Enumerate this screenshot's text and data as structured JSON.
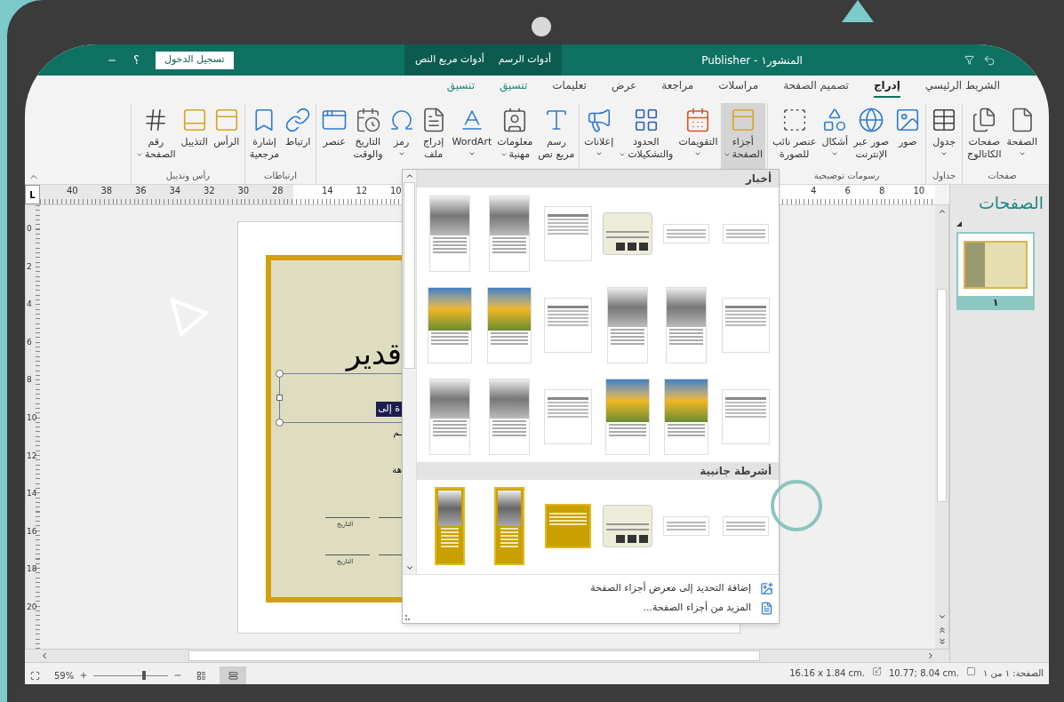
{
  "title_bar": {
    "title": "المنشور١ - Publisher",
    "contextual_tabs": [
      "أدوات الرسم",
      "أدوات مربع النص"
    ],
    "sign_in": "تسجيل الدخول",
    "help": "؟"
  },
  "tabs": [
    {
      "label": "الشريط الرئيسي",
      "selected": false,
      "contextual": false
    },
    {
      "label": "إدراج",
      "selected": true,
      "contextual": false
    },
    {
      "label": "تصميم الصفحة",
      "selected": false,
      "contextual": false
    },
    {
      "label": "مراسلات",
      "selected": false,
      "contextual": false
    },
    {
      "label": "مراجعة",
      "selected": false,
      "contextual": false
    },
    {
      "label": "عرض",
      "selected": false,
      "contextual": false
    },
    {
      "label": "تعليمات",
      "selected": false,
      "contextual": false
    },
    {
      "label": "تنسيق",
      "selected": false,
      "contextual": true
    },
    {
      "label": "تنسيق",
      "selected": false,
      "contextual": true
    }
  ],
  "ribbon": {
    "groups": [
      {
        "label": "صفحات",
        "buttons": [
          {
            "kind": "page",
            "label": "الصفحة",
            "dropdown": true,
            "pressed": false
          },
          {
            "kind": "catalog",
            "label": "صفحات\nالكاتالوج",
            "dropdown": false,
            "pressed": false
          }
        ]
      },
      {
        "label": "جداول",
        "buttons": [
          {
            "kind": "table",
            "label": "جدول",
            "dropdown": true,
            "pressed": false
          }
        ]
      },
      {
        "label": "رسومات توضيحية",
        "buttons": [
          {
            "kind": "pictures",
            "label": "صور",
            "dropdown": false,
            "pressed": false
          },
          {
            "kind": "onlinepictures",
            "label": "صور عبر\nالإنترنت",
            "dropdown": false,
            "pressed": false
          },
          {
            "kind": "shapes",
            "label": "أشكال",
            "dropdown": true,
            "pressed": false
          },
          {
            "kind": "placeholder",
            "label": "عنصر نائب\nللصورة",
            "dropdown": false,
            "pressed": false
          }
        ]
      },
      {
        "buttons": [
          {
            "kind": "pageparts",
            "label": "أجزاء\nالصفحة",
            "dropdown": true,
            "pressed": true
          },
          {
            "kind": "calendars",
            "label": "التقويمات",
            "dropdown": true,
            "pressed": false
          },
          {
            "kind": "borders",
            "label": "الحدود\nوالتشكيلات",
            "dropdown": true,
            "pressed": false
          },
          {
            "kind": "ads",
            "label": "إعلانات",
            "dropdown": true,
            "pressed": false
          }
        ]
      },
      {
        "buttons": [
          {
            "kind": "textbox",
            "label": "رسم\nمربع نص",
            "dropdown": false,
            "pressed": false
          },
          {
            "kind": "businessinfo",
            "label": "معلومات\nمهنية",
            "dropdown": true,
            "pressed": false
          },
          {
            "kind": "wordart",
            "label": "WordArt",
            "dropdown": true,
            "pressed": false
          },
          {
            "kind": "insertfile",
            "label": "إدراج\nملف",
            "dropdown": false,
            "pressed": false
          },
          {
            "kind": "symbol",
            "label": "رمز",
            "dropdown": true,
            "pressed": false
          },
          {
            "kind": "datetime",
            "label": "التاريخ\nوالوقت",
            "dropdown": false,
            "pressed": false
          },
          {
            "kind": "object",
            "label": "عنصر",
            "dropdown": false,
            "pressed": false
          }
        ]
      },
      {
        "label": "ارتباطات",
        "buttons": [
          {
            "kind": "link",
            "label": "ارتباط",
            "dropdown": false,
            "pressed": false
          },
          {
            "kind": "bookmark",
            "label": "إشارة\nمرجعية",
            "dropdown": false,
            "pressed": false
          }
        ]
      },
      {
        "label": "رأس وتذييل",
        "buttons": [
          {
            "kind": "header",
            "label": "الرأس",
            "dropdown": false,
            "pressed": false
          },
          {
            "kind": "footer",
            "label": "التذييل",
            "dropdown": false,
            "pressed": false
          },
          {
            "kind": "pagenumber",
            "label": "رقم\nالصفحة",
            "dropdown": true,
            "pressed": false
          }
        ]
      }
    ]
  },
  "ruler": {
    "tab_stop": "L",
    "horizontal_segments": [
      [
        "10",
        "8",
        "6",
        "4"
      ],
      [
        "10",
        "12",
        "14"
      ],
      [
        "28",
        "30",
        "32",
        "34",
        "36",
        "38",
        "40"
      ]
    ],
    "vertical": [
      "0",
      "2",
      "4",
      "6",
      "8",
      "10",
      "12",
      "14",
      "16",
      "18",
      "20"
    ]
  },
  "document": {
    "title_fragment": "قدير",
    "highlighted_fragment": "ة إلى",
    "line_fragments": [
      "ـم",
      "هة"
    ],
    "date_labels": [
      "التاريخ",
      "التاريخ"
    ]
  },
  "gallery": {
    "sections": [
      {
        "title": "أخبار",
        "items": [
          {
            "kind": "banner"
          },
          {
            "kind": "banner"
          },
          {
            "kind": "card"
          },
          {
            "kind": "text"
          },
          {
            "kind": "photo"
          },
          {
            "kind": "photo"
          },
          {
            "kind": "text"
          },
          {
            "kind": "photo"
          },
          {
            "kind": "photo"
          },
          {
            "kind": "text"
          },
          {
            "kind": "colorphoto"
          },
          {
            "kind": "colorphoto"
          },
          {
            "kind": "text"
          },
          {
            "kind": "colorphoto"
          },
          {
            "kind": "colorphoto"
          },
          {
            "kind": "text"
          },
          {
            "kind": "photo"
          },
          {
            "kind": "photo"
          }
        ]
      },
      {
        "title": "أشرطة جانبية",
        "items": [
          {
            "kind": "banner"
          },
          {
            "kind": "banner"
          },
          {
            "kind": "card"
          },
          {
            "kind": "framedtext"
          },
          {
            "kind": "framedphoto"
          },
          {
            "kind": "framedphoto"
          }
        ]
      }
    ],
    "actions": [
      "إضافة التحديد إلى معرض أجزاء الصفحة",
      "المزيد من أجزاء الصفحة..."
    ]
  },
  "pages_pane": {
    "title": "الصفحات",
    "pages": [
      {
        "number": "١",
        "selected": true
      }
    ]
  },
  "status_bar": {
    "page": "الصفحة: ١ من ١",
    "position": "10.77; 8.04 cm.",
    "size": "16.16 x 1.84 cm.",
    "zoom": "59%",
    "zoom_slider": {
      "level": 0.67
    },
    "views": [
      {
        "selected": false
      },
      {
        "selected": true
      }
    ]
  }
}
